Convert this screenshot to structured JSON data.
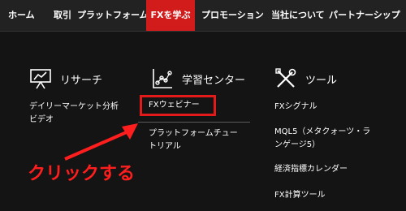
{
  "nav": {
    "items": [
      {
        "label": "ホーム"
      },
      {
        "label": "取引"
      },
      {
        "label": "プラットフォーム"
      },
      {
        "label": "FXを学ぶ"
      },
      {
        "label": "プロモーション"
      },
      {
        "label": "当社について"
      },
      {
        "label": "パートナーシップ"
      }
    ],
    "active_index": 3
  },
  "columns": [
    {
      "title": "リサーチ",
      "icon": "chart-board-icon",
      "links": [
        {
          "label": "デイリーマーケット分析ビデオ"
        }
      ]
    },
    {
      "title": "学習センター",
      "icon": "scatter-chart-icon",
      "links": [
        {
          "label": "FXウェビナー"
        },
        {
          "label": "プラットフォームチュートリアル"
        }
      ]
    },
    {
      "title": "ツール",
      "icon": "tools-icon",
      "links": [
        {
          "label": "FXシグナル"
        },
        {
          "label": "MQL5（メタクォーツ・ランゲージ5）"
        },
        {
          "label": "経済指標カレンダー"
        },
        {
          "label": "FX計算ツール"
        }
      ]
    }
  ],
  "annotation": {
    "text": "クリックする"
  },
  "colors": {
    "accent": "#d21c1c",
    "annotation": "#ff1e1e",
    "background": "#141414",
    "nav_background": "#222222"
  }
}
